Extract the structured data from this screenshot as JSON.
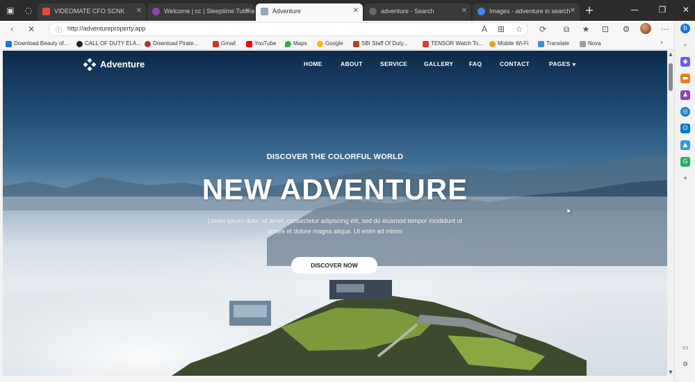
{
  "browser": {
    "tabs": [
      {
        "label": "VIDEOMATE CFO SCNK",
        "favicon_color": "#e24a3b",
        "active": false
      },
      {
        "label": "Welcome | cc | Sleeptime Tutorial",
        "favicon_color": "#8e44ad",
        "active": false
      },
      {
        "label": "Adventure",
        "favicon_color": "#9aa7b5",
        "active": true
      },
      {
        "label": "adventure - Search",
        "favicon_color": "#666666",
        "active": false
      },
      {
        "label": "Images - adventure in search",
        "favicon_color": "#4285f4",
        "active": false
      }
    ],
    "address": "http://adventureproperty.app",
    "bookmarks": [
      {
        "label": "Download Beauty of...",
        "icon_color": "#1a73e8"
      },
      {
        "label": "CALL OF DUTY ELA...",
        "icon_color": "#222222"
      },
      {
        "label": "Download Pirate...",
        "icon_color": "#b03030"
      },
      {
        "label": "Gmail",
        "icon_color": "#d93025"
      },
      {
        "label": "YouTube",
        "icon_color": "#ff0000"
      },
      {
        "label": "Maps",
        "icon_color": "#34a853"
      },
      {
        "label": "Google",
        "icon_color": "#fbbc05"
      },
      {
        "label": "SBI Staff Of Duty...",
        "icon_color": "#c0392b"
      },
      {
        "label": "TENSOR Watch To...",
        "icon_color": "#e53935"
      },
      {
        "label": "Mobile Wi-Fi",
        "icon_color": "#f39c12"
      },
      {
        "label": "Translate",
        "icon_color": "#4285f4"
      },
      {
        "label": "Nova",
        "icon_color": "#9e9e9e"
      }
    ]
  },
  "site": {
    "brand": "Adventure",
    "nav": [
      "HOME",
      "ABOUT",
      "SERVICE",
      "GALLERY",
      "FAQ",
      "CONTACT",
      "PAGES"
    ],
    "hero": {
      "kicker": "DISCOVER THE COLORFUL WORLD",
      "title": "NEW ADVENTURE",
      "text": "Lorem ipsum dolor sit amet, consectetur adipiscing elit, sed do eiusmod tempor incididunt ut labore et dolore magna aliqua. Ut enim ad minim",
      "cta": "DISCOVER NOW"
    }
  },
  "colors": {
    "sky_top": "#0d2a4a",
    "cta_bg": "#ffffff",
    "accent_blue": "#1a73e8"
  }
}
